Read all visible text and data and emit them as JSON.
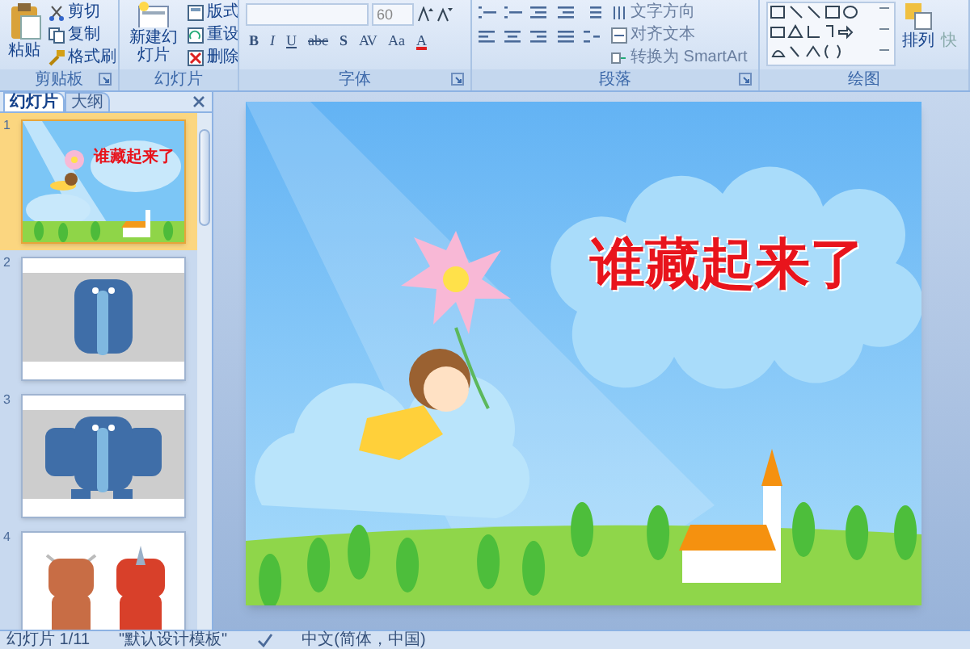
{
  "ribbon": {
    "clipboard": {
      "label": "剪贴板",
      "paste": "粘贴",
      "buttons": [
        "剪切",
        "复制",
        "格式刷"
      ]
    },
    "slides": {
      "label": "幻灯片",
      "new_slide": "新建幻灯片",
      "buttons": [
        "版式",
        "重设",
        "删除"
      ]
    },
    "font": {
      "label": "字体",
      "size": "60",
      "format_buttons": [
        "B",
        "I",
        "U",
        "abc",
        "S",
        "AV",
        "Aa",
        "A"
      ]
    },
    "paragraph": {
      "label": "段落",
      "buttons": [
        "文字方向",
        "对齐文本",
        "转换为 SmartArt"
      ]
    },
    "drawing": {
      "label": "绘图",
      "arrange": "排列",
      "column_2": "快"
    }
  },
  "panel": {
    "tabs": [
      {
        "label": "幻灯片",
        "selected": true
      },
      {
        "label": "大纲",
        "selected": false
      }
    ],
    "slides": [
      {
        "number": "1",
        "selected": true,
        "kind": "title",
        "title": "谁藏起来了"
      },
      {
        "number": "2",
        "selected": false,
        "kind": "elephant"
      },
      {
        "number": "3",
        "selected": false,
        "kind": "elephant_full"
      },
      {
        "number": "4",
        "selected": false,
        "kind": "animals"
      }
    ]
  },
  "slide": {
    "title": "谁藏起来了"
  },
  "status_bar": {
    "slide_count": "幻灯片 1/11",
    "theme": "\"默认设计模板\"",
    "language": "中文(简体，中国)"
  }
}
